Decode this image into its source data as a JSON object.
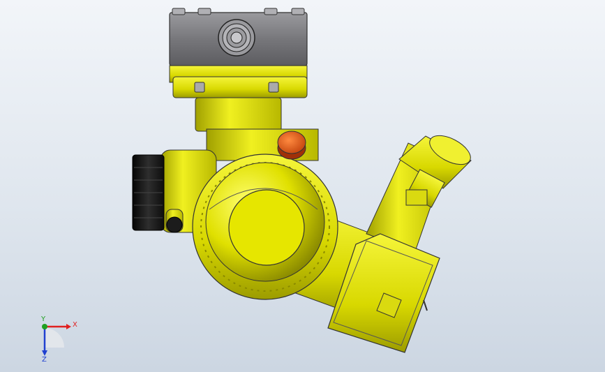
{
  "view": {
    "colors": {
      "background_top": "#f2f5f9",
      "background_bottom": "#ccd6e2",
      "part_yellow": "#e5e500",
      "part_yellow_shadow": "#8c8c00",
      "housing_gray": "#7c7c80",
      "knob_black": "#1a1a1a",
      "cap_orange": "#e85a10"
    }
  },
  "triad": {
    "x_label": "X",
    "y_label": "Y",
    "z_label": "Z",
    "x_color": "#e02020",
    "y_color": "#20a020",
    "z_color": "#2040d0"
  }
}
